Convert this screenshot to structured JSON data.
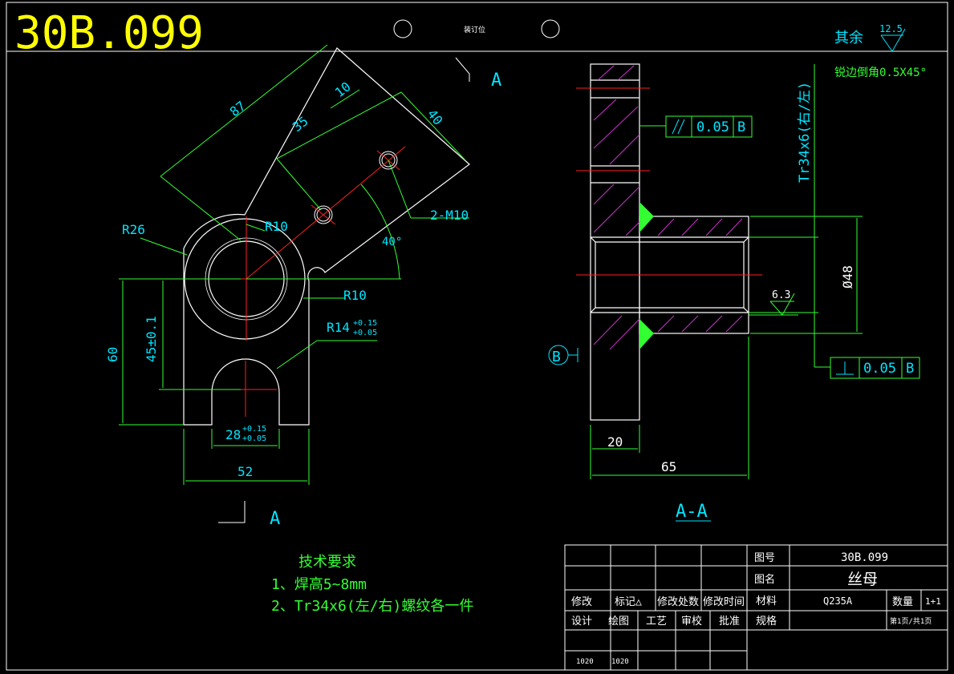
{
  "drawing_number_big": "30B.099",
  "binding_label": "装订位",
  "roughness": {
    "others_label": "其余",
    "others_value": "12.5",
    "bore_value": "6.3"
  },
  "chamfer_note": "锐边倒角0.5X45°",
  "section_marker": "A",
  "section_title": "A-A",
  "datum_b": "B",
  "tolerances": {
    "parallel_value": "0.05",
    "parallel_datum": "B",
    "perp_value": "0.05",
    "perp_datum": "B"
  },
  "dims_left": {
    "d87": "87",
    "d10": "10",
    "d35": "35",
    "d40": "40",
    "holes": "2-M10",
    "angle": "40°",
    "r26": "R26",
    "r10_top": "R10",
    "r10_right": "R10",
    "r14": "R14",
    "r14_upper": "+0.15",
    "r14_lower": "+0.05",
    "d60": "60",
    "d45": "45±0.1",
    "d28": "28",
    "d28_upper": "+0.15",
    "d28_lower": "+0.05",
    "d52": "52"
  },
  "dims_right": {
    "thread": "Tr34x6(右/左)",
    "bore": "Ø48",
    "d20": "20",
    "d65": "65"
  },
  "tech": {
    "title": "技术要求",
    "items": [
      "1、焊高5~8mm",
      "2、Tr34x6(左/右)螺纹各一件"
    ]
  },
  "title_block": {
    "row_mod": [
      "修改",
      "标记△",
      "修改处数",
      "修改时间"
    ],
    "row_design": [
      "设计",
      "绘图",
      "工艺",
      "审校",
      "批准"
    ],
    "dates": [
      "1020",
      "1020"
    ],
    "drawing_no_label": "图号",
    "drawing_no": "30B.099",
    "name_label": "图名",
    "name": "丝母",
    "material_label": "材料",
    "material": "Q235A",
    "qty_label": "数量",
    "qty": "1+1",
    "spec_label": "规格",
    "page": "第1页/共1页"
  }
}
